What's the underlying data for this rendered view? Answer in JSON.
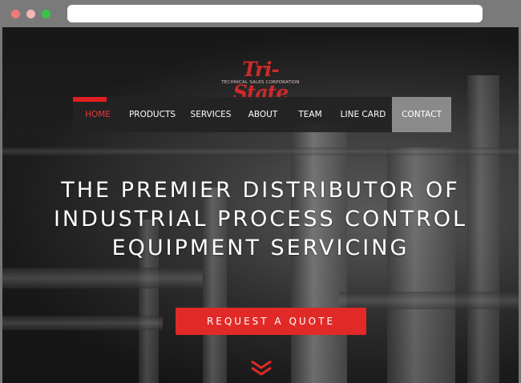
{
  "browser": {
    "url": ""
  },
  "brand": {
    "name": "Tri-State",
    "tagline": "TECHNICAL SALES CORPORATION",
    "accent": "#e12a27"
  },
  "nav": {
    "items": [
      {
        "label": "HOME",
        "active": true
      },
      {
        "label": "PRODUCTS"
      },
      {
        "label": "SERVICES"
      },
      {
        "label": "ABOUT"
      },
      {
        "label": "TEAM"
      },
      {
        "label": "LINE CARD"
      },
      {
        "label": "CONTACT"
      }
    ]
  },
  "hero": {
    "line1": "THE PREMIER DISTRIBUTOR OF",
    "line2": "INDUSTRIAL PROCESS CONTROL",
    "line3": "EQUIPMENT SERVICING",
    "cta_label": "REQUEST A QUOTE"
  },
  "icons": {
    "scroll": "chevron-down-double-icon"
  }
}
